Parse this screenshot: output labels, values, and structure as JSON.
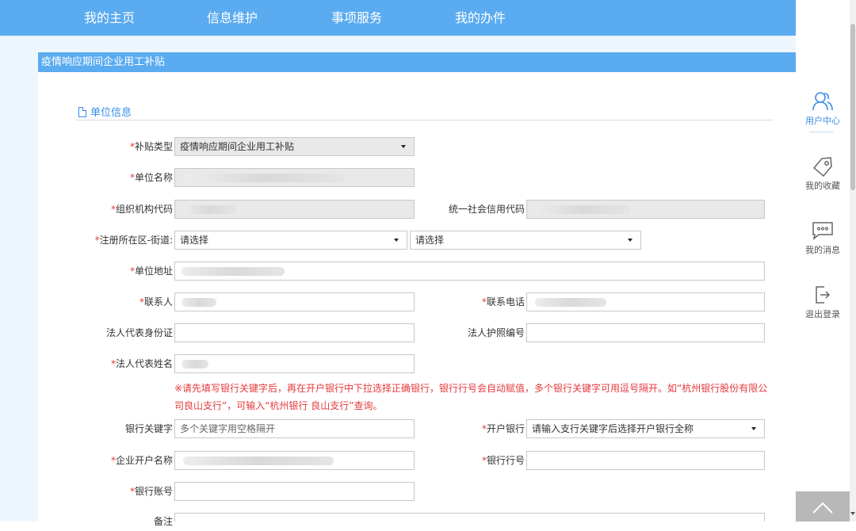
{
  "nav": {
    "items": [
      "我的主页",
      "信息维护",
      "事项服务",
      "我的办件"
    ]
  },
  "panel": {
    "title": "疫情响应期间企业用工补贴",
    "section_title": "单位信息"
  },
  "form": {
    "subsidy_type": {
      "label": "补贴类型",
      "value": "疫情响应期间企业用工补贴"
    },
    "unit_name": {
      "label": "单位名称"
    },
    "org_code": {
      "label": "组织机构代码"
    },
    "credit_code": {
      "label": "统一社会信用代码"
    },
    "district": {
      "label": "注册所在区-街道:",
      "district_value": "请选择",
      "street_value": "请选择"
    },
    "address": {
      "label": "单位地址"
    },
    "contact": {
      "label": "联系人"
    },
    "phone": {
      "label": "联系电话"
    },
    "legal_id": {
      "label": "法人代表身份证"
    },
    "passport": {
      "label": "法人护照编号"
    },
    "legal_name": {
      "label": "法人代表姓名"
    },
    "notice": "※请先填写银行关键字后，再在开户银行中下拉选择正确银行，银行行号会自动赋值，多个银行关键字可用逗号隔开。如“杭州银行股份有限公司良山支行”，可输入“杭州银行 良山支行”查询。",
    "bank_keyword": {
      "label": "银行关键字",
      "placeholder": "多个关键字用空格隔开"
    },
    "open_bank": {
      "label": "开户银行",
      "value": "请输入支行关键字后选择开户银行全称"
    },
    "account_name": {
      "label": "企业开户名称"
    },
    "bank_code": {
      "label": "银行行号"
    },
    "account_no": {
      "label": "银行账号"
    },
    "remark": {
      "label": "备注"
    },
    "required_mark": "*"
  },
  "sidebar": {
    "user_center": "用户中心",
    "favorites": "我的收藏",
    "messages": "我的消息",
    "logout": "退出登录"
  },
  "colors": {
    "accent": "#5aabf0",
    "link": "#3a8ee6",
    "required": "#e4393c"
  }
}
